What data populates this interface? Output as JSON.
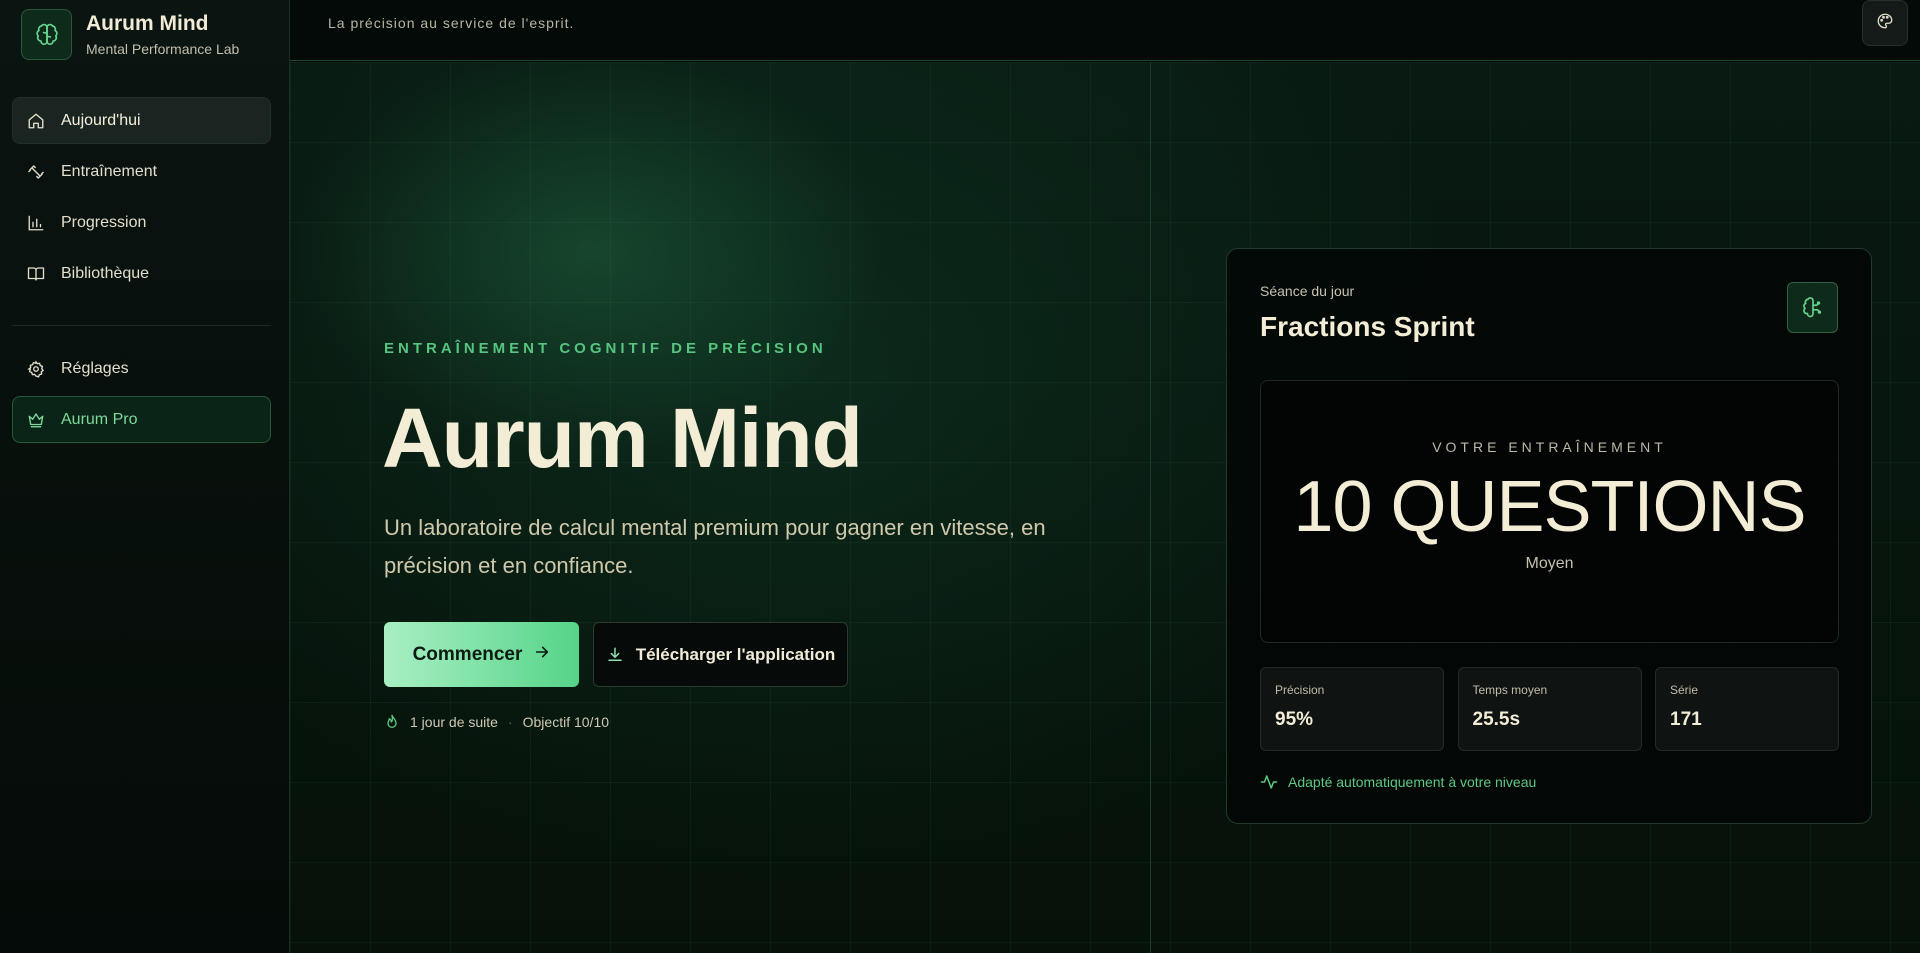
{
  "brand": {
    "name": "Aurum Mind",
    "subtitle": "Mental Performance Lab",
    "logo_icon": "brain-icon"
  },
  "sidebar": {
    "items": [
      {
        "label": "Aujourd'hui",
        "icon": "home-icon",
        "active": true
      },
      {
        "label": "Entraînement",
        "icon": "dumbbell-icon"
      },
      {
        "label": "Progression",
        "icon": "bar-chart-icon"
      },
      {
        "label": "Bibliothèque",
        "icon": "book-icon"
      }
    ],
    "settings": {
      "label": "Réglages",
      "icon": "gear-icon"
    },
    "pro": {
      "label": "Aurum Pro",
      "icon": "crown-icon"
    }
  },
  "topbar": {
    "tagline": "La précision au service de l'esprit.",
    "palette_icon": "palette-icon"
  },
  "hero": {
    "eyebrow": "ENTRAÎNEMENT COGNITIF DE PRÉCISION",
    "title": "Aurum Mind",
    "description": "Un laboratoire de calcul mental premium pour gagner en vitesse, en précision et en confiance.",
    "primary_button": "Commencer",
    "secondary_button": "Télécharger l'application",
    "streak": "1 jour de suite",
    "separator": "·",
    "objective": "Objectif 10/10"
  },
  "session": {
    "kicker": "Séance du jour",
    "title": "Fractions Sprint",
    "icon": "brain-circuit-icon",
    "panel_kicker": "VOTRE ENTRAÎNEMENT",
    "panel_value": "10 QUESTIONS",
    "panel_level": "Moyen",
    "stats": [
      {
        "label": "Précision",
        "value": "95%"
      },
      {
        "label": "Temps moyen",
        "value": "25.5s"
      },
      {
        "label": "Série",
        "value": "171"
      }
    ],
    "footer": "Adapté automatiquement à votre niveau"
  },
  "colors": {
    "accent": "#56c57f",
    "background": "#040907",
    "text": "#f3edd6"
  }
}
